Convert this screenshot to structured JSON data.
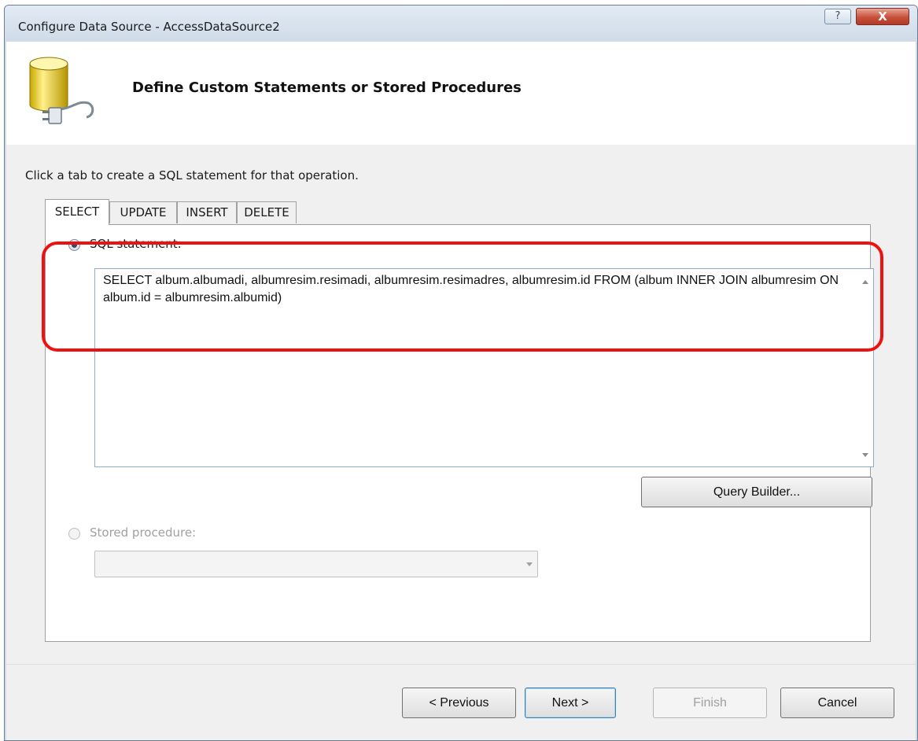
{
  "window": {
    "title": "Configure Data Source - AccessDataSource2",
    "help_label": "?",
    "close_label": "X"
  },
  "header": {
    "icon": "database-plug-icon",
    "title": "Define Custom Statements or Stored Procedures"
  },
  "instruction": "Click a tab to create a SQL statement for that operation.",
  "tabs": [
    {
      "label": "SELECT",
      "active": true
    },
    {
      "label": "UPDATE",
      "active": false
    },
    {
      "label": "INSERT",
      "active": false
    },
    {
      "label": "DELETE",
      "active": false
    }
  ],
  "sql_statement": {
    "radio_label": "SQL statement:",
    "checked": true,
    "value": "SELECT album.albumadi, albumresim.resimadi, albumresim.resimadres, albumresim.id FROM (album INNER JOIN albumresim ON album.id = albumresim.albumid)"
  },
  "query_builder_label": "Query Builder...",
  "stored_procedure": {
    "radio_label": "Stored procedure:",
    "enabled": false,
    "selected": ""
  },
  "footer": {
    "previous_label": "< Previous",
    "next_label": "Next >",
    "finish_label": "Finish",
    "cancel_label": "Cancel"
  },
  "colors": {
    "highlight": "#ee1111",
    "dialog_frame": "#cfdbe8"
  }
}
